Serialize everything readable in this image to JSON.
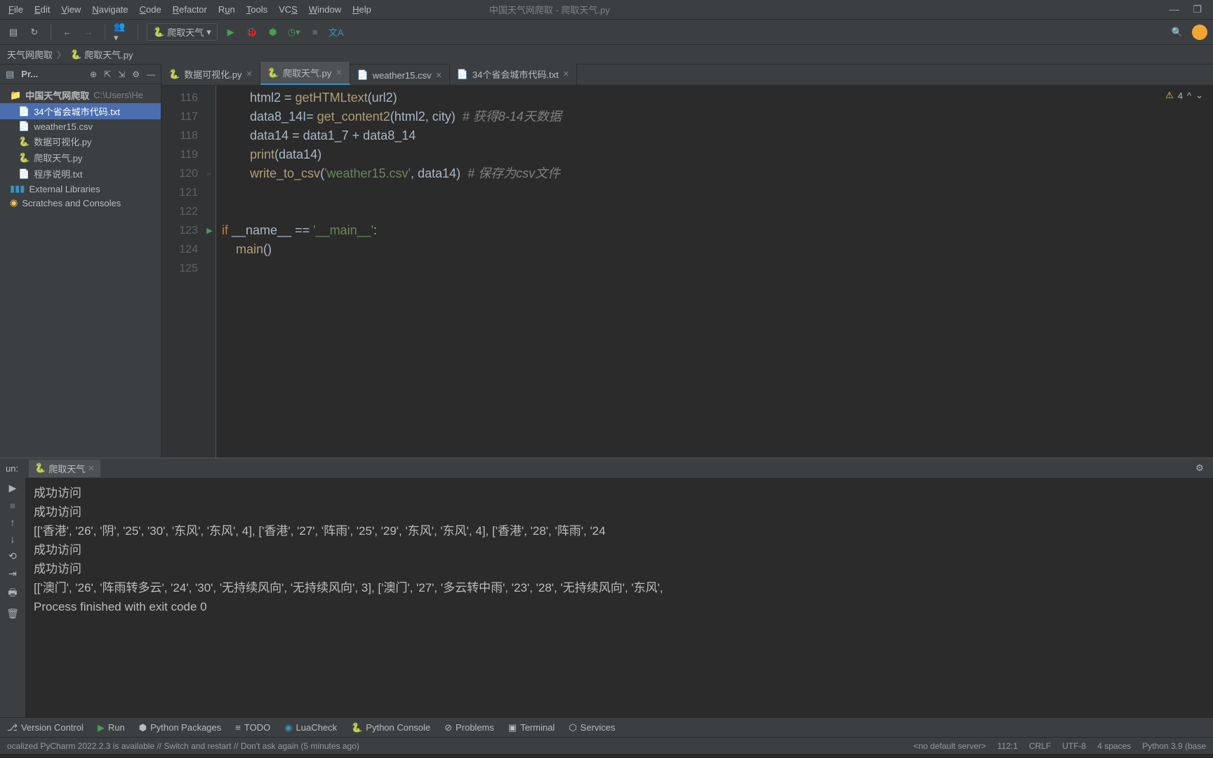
{
  "window": {
    "title": "中国天气网爬取 - 爬取天气.py"
  },
  "menu": {
    "file": "File",
    "edit": "Edit",
    "view": "View",
    "navigate": "Navigate",
    "code": "Code",
    "refactor": "Refactor",
    "run": "Run",
    "tools": "Tools",
    "vcs": "VCS",
    "window": "Window",
    "help": "Help"
  },
  "toolbar": {
    "run_config": "爬取天气"
  },
  "breadcrumb": {
    "root": "天气网爬取",
    "file": "爬取天气.py"
  },
  "project": {
    "panel_title": "Pr...",
    "root_name": "中国天气网爬取",
    "root_path": "C:\\Users\\He",
    "files": {
      "f0": "34个省会城市代码.txt",
      "f1": "weather15.csv",
      "f2": "数据可视化.py",
      "f3": "爬取天气.py",
      "f4": "程序说明.txt"
    },
    "external": "External Libraries",
    "scratches": "Scratches and Consoles"
  },
  "tabs": {
    "t0": "数据可视化.py",
    "t1": "爬取天气.py",
    "t2": "weather15.csv",
    "t3": "34个省会城市代码.txt"
  },
  "inspection": {
    "count": "4"
  },
  "gutter": {
    "l116": "116",
    "l117": "117",
    "l118": "118",
    "l119": "119",
    "l120": "120",
    "l121": "121",
    "l122": "122",
    "l123": "123",
    "l124": "124",
    "l125": "125"
  },
  "code": {
    "l116": {
      "indent": "        ",
      "a": "html2 = ",
      "fn": "getHTMLtext",
      "b": "(url2)"
    },
    "l117": {
      "indent": "        ",
      "a": "data8_14I= ",
      "fn": "get_content2",
      "b": "(html2, city)  ",
      "c": "# 获得8-14天数据"
    },
    "l118": {
      "indent": "        ",
      "a": "data14 = data1_7 + data8_14"
    },
    "l119": {
      "indent": "        ",
      "fn": "print",
      "b": "(data14)"
    },
    "l120": {
      "indent": "        ",
      "fn": "write_to_csv",
      "b": "(",
      "s": "'weather15.csv'",
      "d": ", data14)  ",
      "c": "# 保存为csv文件"
    },
    "l123": {
      "kw1": "if",
      "a": " __name__ == ",
      "s": "'__main__'",
      "b": ":"
    },
    "l124": {
      "indent": "    ",
      "fn": "main",
      "b": "()"
    }
  },
  "run": {
    "label": "un:",
    "tab": "爬取天气"
  },
  "console": {
    "line1": "成功访问",
    "line2": "成功访问",
    "line3": "[['香港', '26', '阴', '25', '30', '东风', '东风', 4], ['香港', '27', '阵雨', '25', '29', '东风', '东风', 4], ['香港', '28', '阵雨', '24",
    "line4": "成功访问",
    "line5": "成功访问",
    "line6": "[['澳门', '26', '阵雨转多云', '24', '30', '无持续风向', '无持续风向', 3], ['澳门', '27', '多云转中雨', '23', '28', '无持续风向', '东风', ",
    "line7": "",
    "line8": "Process finished with exit code 0"
  },
  "bottom": {
    "version": "Version Control",
    "run": "Run",
    "packages": "Python Packages",
    "todo": "TODO",
    "luacheck": "LuaCheck",
    "pyconsole": "Python Console",
    "problems": "Problems",
    "terminal": "Terminal",
    "services": "Services"
  },
  "status": {
    "msg": "ocalized PyCharm 2022.2.3 is available // Switch and restart // Don't ask again (5 minutes ago)",
    "server": "<no default server>",
    "pos": "112:1",
    "eol": "CRLF",
    "enc": "UTF-8",
    "indent": "4 spaces",
    "interp": "Python 3.9 (base"
  }
}
